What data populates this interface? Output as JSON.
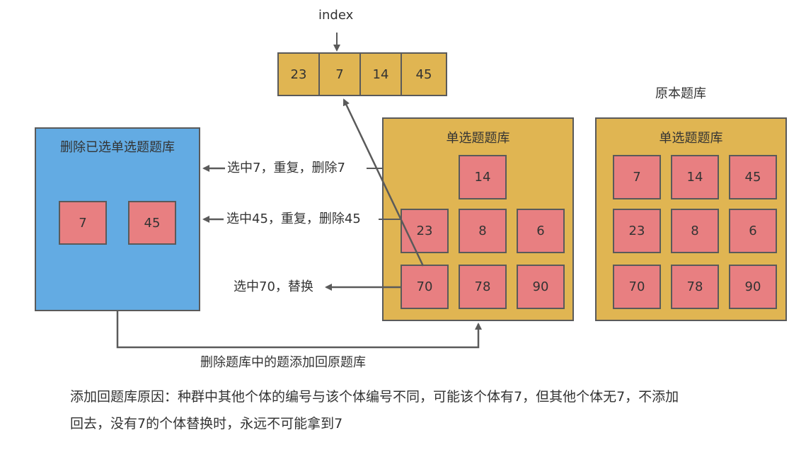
{
  "index_label": "index",
  "index_array": [
    "23",
    "7",
    "14",
    "45"
  ],
  "original_bank": {
    "caption": "原本题库",
    "title": "单选题题库",
    "cells": [
      "7",
      "14",
      "45",
      "23",
      "8",
      "6",
      "70",
      "78",
      "90"
    ]
  },
  "current_bank": {
    "title": "单选题题库",
    "cells": [
      "14",
      "23",
      "8",
      "6",
      "70",
      "78",
      "90"
    ]
  },
  "deleted_bank": {
    "title": "删除已选单选题题库",
    "cells": [
      "7",
      "45"
    ]
  },
  "arrow_labels": {
    "pick7": "选中7，重复，删除7",
    "pick45": "选中45，重复，删除45",
    "pick70": "选中70，替换",
    "add_back": "删除题库中的题添加回原题库"
  },
  "note": {
    "line1": "添加回题库原因：种群中其他个体的编号与该个体编号不同，可能该个体有7，但其他个体无7，不添加",
    "line2": "回去，没有7的个体替换时，永远不可能拿到7"
  },
  "colors": {
    "gold": "#e0b552",
    "red": "#e87f81",
    "blue": "#63abe3",
    "line": "#5a5a5a"
  }
}
